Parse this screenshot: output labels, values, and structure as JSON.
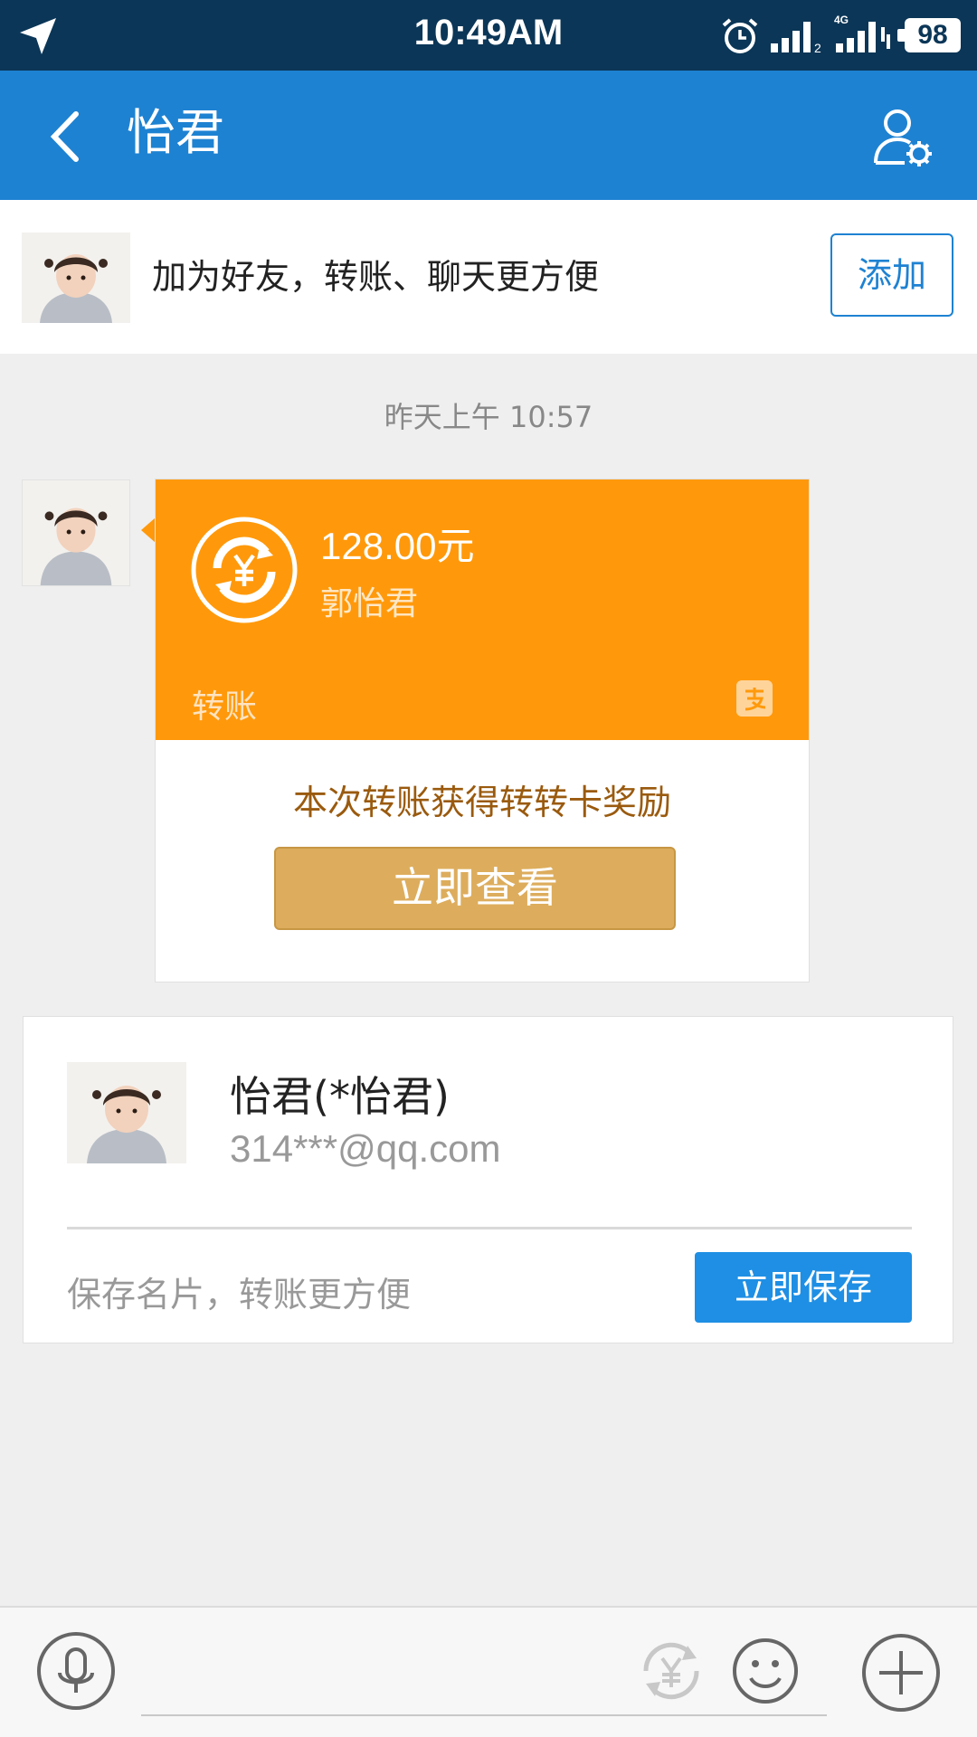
{
  "status_bar": {
    "time": "10:49AM",
    "network": "4G",
    "battery": "98"
  },
  "header": {
    "title": "怡君",
    "back_icon": "chevron-left-icon",
    "profile_icon": "user-settings-icon"
  },
  "add_friend_banner": {
    "text": "加为好友，转账、聊天更方便",
    "button_label": "添加"
  },
  "chat": {
    "timestamp": "昨天上午 10:57",
    "transfer_message": {
      "amount": "128.00元",
      "payee": "郭怡君",
      "type_label": "转账",
      "reward_text": "本次转账获得转转卡奖励",
      "view_button_label": "立即查看",
      "card_color": "#ff990b"
    }
  },
  "contact_card": {
    "name": "怡君(*怡君)",
    "email": "314***@qq.com",
    "save_hint": "保存名片，转账更方便",
    "save_button_label": "立即保存"
  },
  "input_bar": {
    "icons": [
      "microphone-icon",
      "yen-transfer-icon",
      "emoji-icon",
      "plus-icon"
    ]
  },
  "colors": {
    "status_bar": "#0b3657",
    "header": "#1e82d2",
    "accent_orange": "#ff990b",
    "gold_button": "#ddad5d",
    "blue_button": "#1e8fe4"
  }
}
